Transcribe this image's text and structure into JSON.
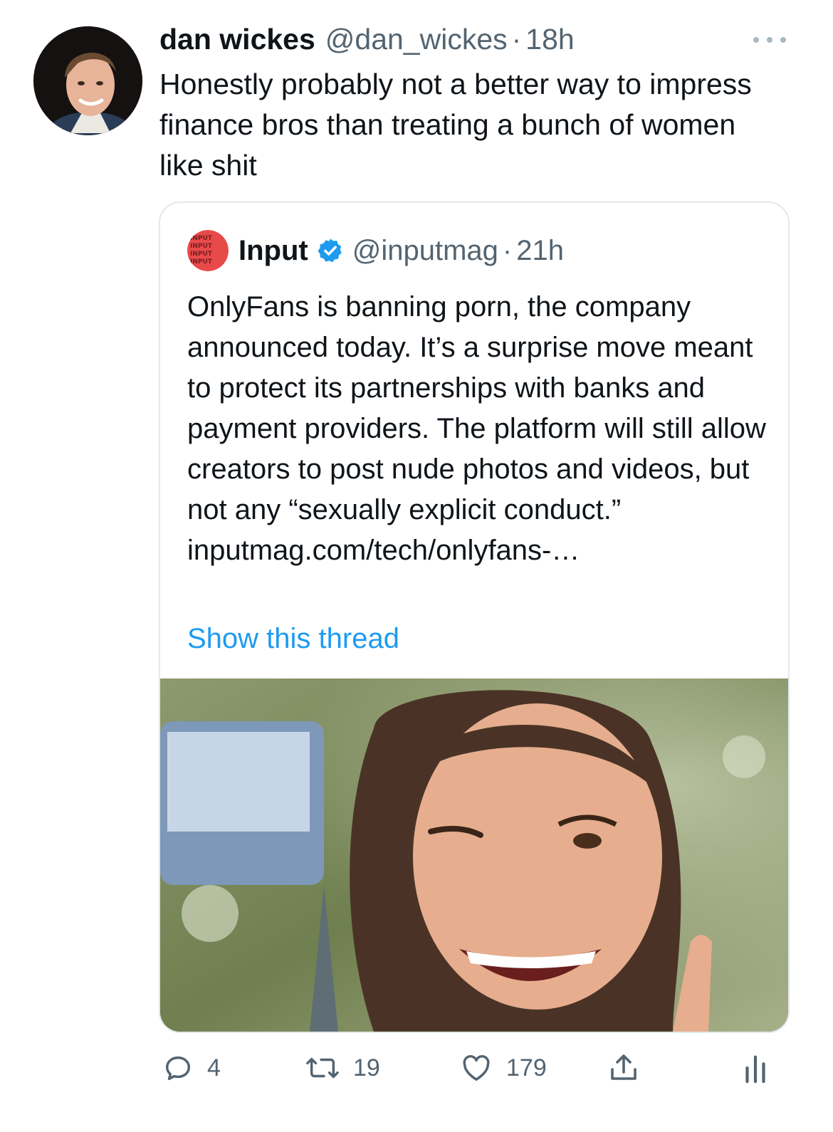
{
  "tweet": {
    "author_name": "dan wickes",
    "author_handle": "@dan_wickes",
    "separator": "·",
    "time": "18h",
    "text": "Honestly probably not a better way to impress finance bros than treating a bunch of women like shit",
    "icons": {
      "avatar": "avatar-photo",
      "more": "more-options-icon"
    }
  },
  "quoted": {
    "author_name": "Input",
    "author_handle": "@inputmag",
    "separator": "·",
    "time": "21h",
    "avatar_logo_text": "INPUT",
    "text": "OnlyFans is banning porn, the company announced today. It’s a surprise move meant to protect its partnerships with banks and payment providers. The platform will still allow creators to post nude photos and videos, but not any “sexually explicit conduct.” inputmag.com/tech/onlyfans-…",
    "show_thread": "Show this thread",
    "colors": {
      "link": "#1d9bf0",
      "verified": "#1d9bf0"
    }
  },
  "actions": {
    "reply_count": "4",
    "retweet_count": "19",
    "like_count": "179",
    "icons": [
      "reply-icon",
      "retweet-icon",
      "like-icon",
      "share-icon",
      "analytics-icon"
    ]
  }
}
